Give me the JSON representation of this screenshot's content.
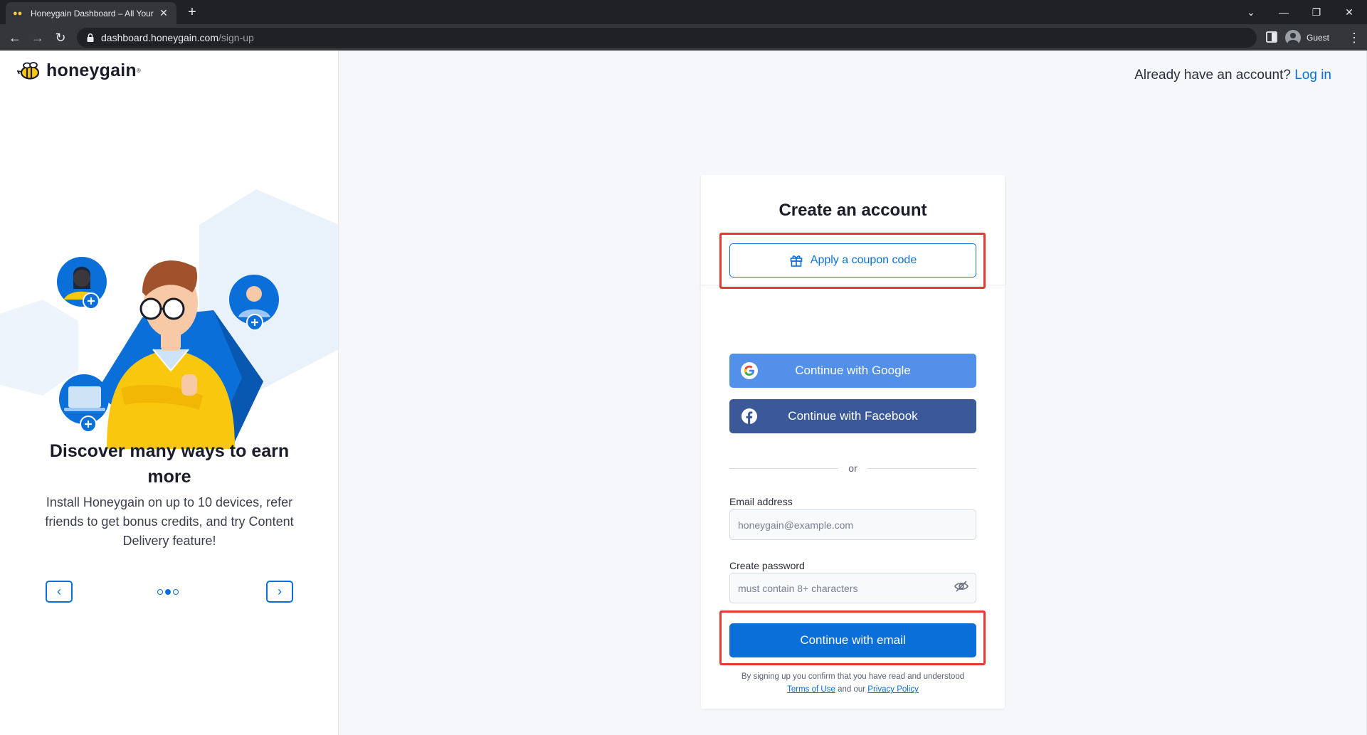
{
  "browser": {
    "tab_title": "Honeygain Dashboard – All Your",
    "tab_close": "✕",
    "new_tab": "+",
    "url_host": "dashboard.honeygain.com",
    "url_path": "/sign-up",
    "profile_label": "Guest",
    "window_controls": {
      "dropdown": "⌄",
      "minimize": "—",
      "restore": "❐",
      "close": "✕"
    },
    "nav": {
      "back": "←",
      "forward": "→",
      "reload": "↻"
    },
    "menu": "⋮"
  },
  "brand": {
    "name": "honeygain",
    "trademark": "®",
    "colors": {
      "primary": "#0a6fd8",
      "yellow": "#f9c80e",
      "google": "#5390e9",
      "facebook": "#3b5998",
      "highlight": "#e53935"
    }
  },
  "header": {
    "account_prompt": "Already have an account?",
    "login_link": "Log in"
  },
  "promo": {
    "title": "Discover many ways to earn more",
    "description": "Install Honeygain on up to 10 devices, refer friends to get bonus credits, and try Content Delivery feature!",
    "prev_icon": "‹",
    "next_icon": "›",
    "slides": 3,
    "active_slide": 2
  },
  "form": {
    "title": "Create an account",
    "coupon_button": "Apply a coupon code",
    "google_button": "Continue with Google",
    "facebook_button": "Continue with Facebook",
    "divider": "or",
    "email_label": "Email address",
    "email_placeholder": "honeygain@example.com",
    "password_label": "Create password",
    "password_placeholder": "must contain 8+ characters",
    "submit_button": "Continue with email",
    "legal_text": "By signing up you confirm that you have read and understood",
    "terms_link": "Terms of Use",
    "legal_and": "and our",
    "privacy_link": "Privacy Policy"
  },
  "icons": [
    "gift-icon",
    "google-icon",
    "facebook-icon",
    "eye-off-icon",
    "bee-logo-icon",
    "chevron-left-icon",
    "chevron-right-icon",
    "lock-icon"
  ]
}
